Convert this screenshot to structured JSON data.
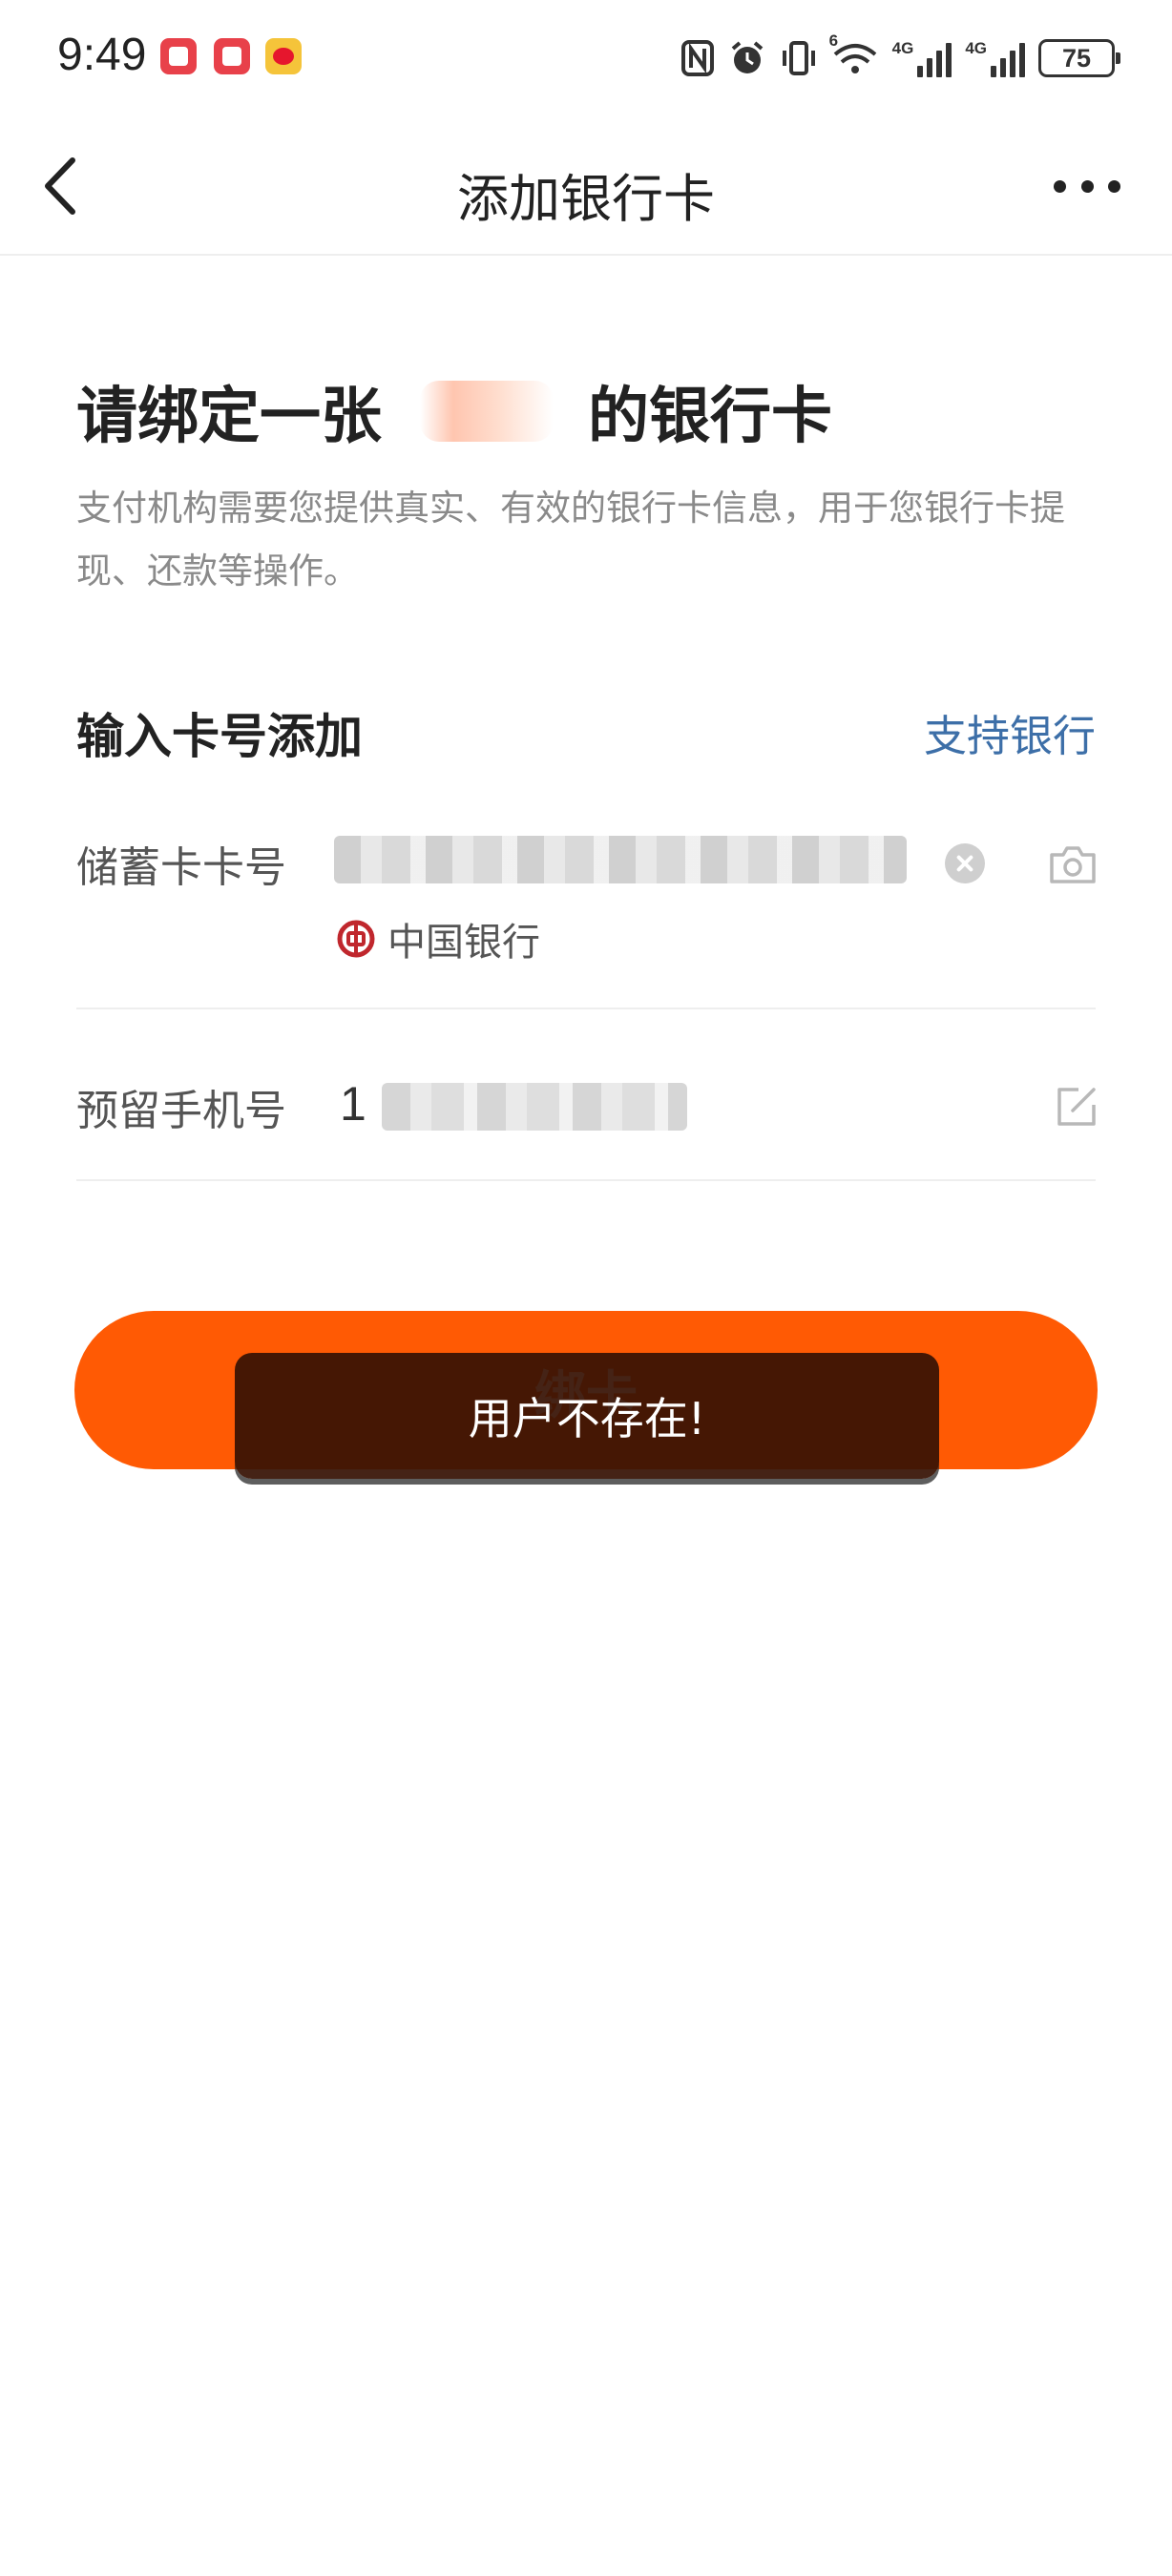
{
  "status_bar": {
    "time": "9:49",
    "network_label_1": "4G",
    "network_label_2": "4G",
    "wifi_badge": "6",
    "battery": "75"
  },
  "navbar": {
    "title": "添加银行卡",
    "back_icon": "chevron-left-icon",
    "more_icon": "more-icon"
  },
  "heading": {
    "prefix": "请绑定一张",
    "suffix": "的银行卡"
  },
  "description": "支付机构需要您提供真实、有效的银行卡信息，用于您银行卡提现、还款等操作。",
  "section": {
    "title": "输入卡号添加",
    "support_link": "支持银行"
  },
  "card_row": {
    "label": "储蓄卡卡号",
    "bank_name": "中国银行",
    "clear_icon": "clear-icon",
    "camera_icon": "camera-icon"
  },
  "phone_row": {
    "label": "预留手机号",
    "value_prefix": "1",
    "edit_icon": "edit-icon"
  },
  "bind_button": {
    "label": "绑卡"
  },
  "toast": {
    "message": "用户不存在!"
  },
  "colors": {
    "accent": "#ff5a04",
    "link": "#3d6fa8",
    "bank_red": "#c0272d",
    "toast_bg": "#37120a"
  }
}
